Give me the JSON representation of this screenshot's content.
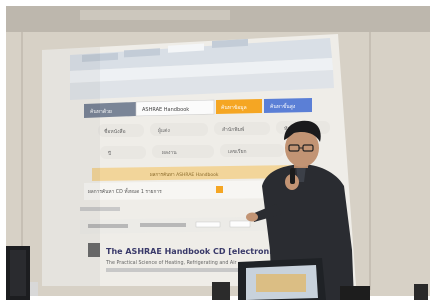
{
  "scene": {
    "kind": "photo of a presenter in front of a projected web page",
    "colors": {
      "wall": "#d8d2c8",
      "screen": "#f2efe9",
      "orange_button": "#f5a623",
      "blue_button": "#5b7fd6",
      "jacket": "#2a2c31"
    }
  },
  "projection": {
    "search_dropdown": "ค้นหาด้วย",
    "search_value": "ASHRAE Handbook",
    "search_button": "ค้นหาข้อมูล",
    "advanced_search_button": "ค้นหาขั้นสูง",
    "tabs_row1": [
      "ชื่อหนังสือ",
      "ผู้แต่ง",
      "สำนักพิมพ์",
      "หัวเรื่อง"
    ],
    "tabs_row2": [
      "ปี",
      "ผลงาน",
      "เลขเรียก"
    ],
    "results_bar": "ผลการค้นหา ASHRAE Handbook",
    "results_line": "ผลการค้นหา CD ทั้งหมด 1 รายการ",
    "result_title": "The ASHRAE Handbook CD [electronic res",
    "result_subtitle": "The Practical Science of Heating, Refrigerating and Air"
  },
  "presenter": {
    "description": "man with glasses holding a microphone and pointing at the screen"
  }
}
